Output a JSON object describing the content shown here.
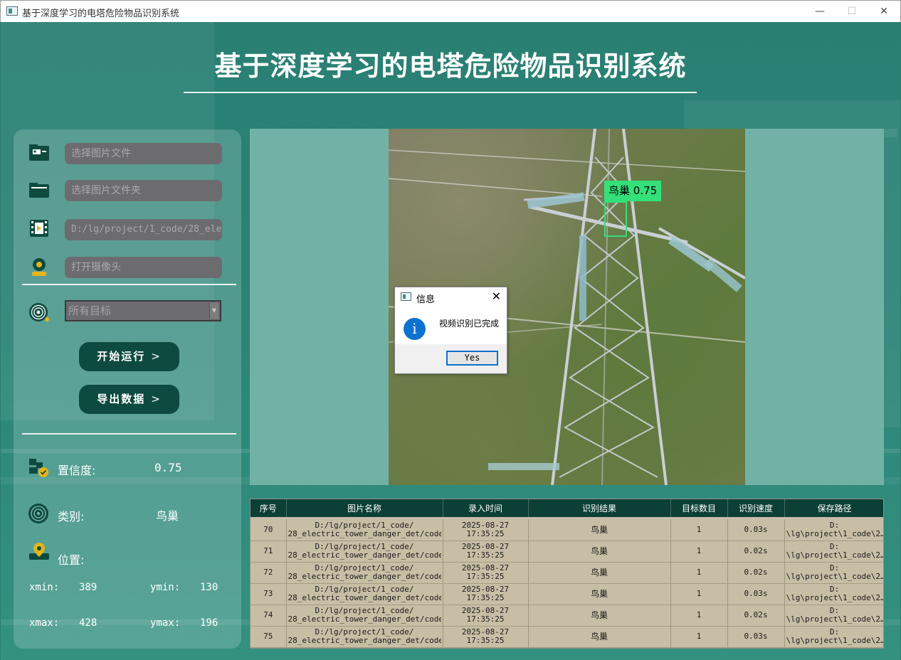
{
  "window": {
    "title": "基于深度学习的电塔危险物品识别系统",
    "minimize_glyph": "—",
    "maximize_glyph": "☐",
    "close_glyph": "✕"
  },
  "header": {
    "title": "基于深度学习的电塔危险物品识别系统"
  },
  "sidebar": {
    "image_file_placeholder": "选择图片文件",
    "image_folder_placeholder": "选择图片文件夹",
    "video_path": "D:/lg/project/1_code/28_ele",
    "camera_placeholder": "打开摄像头",
    "target_select_value": "所有目标",
    "start_button": "开始运行",
    "export_button": "导出数据",
    "chevron": ">",
    "confidence_label": "置信度:",
    "confidence_value": "0.75",
    "category_label": "类别:",
    "category_value": "鸟巢",
    "position_label": "位置:",
    "xmin_label": "xmin:",
    "xmin_value": "389",
    "ymin_label": "ymin:",
    "ymin_value": "130",
    "xmax_label": "xmax:",
    "xmax_value": "428",
    "ymax_label": "ymax:",
    "ymax_value": "196"
  },
  "detection": {
    "label": "鸟巢 0.75"
  },
  "dialog": {
    "title": "信息",
    "close_glyph": "✕",
    "info_glyph": "i",
    "message": "视频识别已完成",
    "yes_button": "Yes"
  },
  "table": {
    "headers": [
      "序号",
      "图片名称",
      "录入时间",
      "识别结果",
      "目标数目",
      "识别速度",
      "保存路径"
    ],
    "rows": [
      {
        "id": "70",
        "name1": "D:/lg/project/1_code/",
        "name2": "28_electric_tower_danger_det/code…",
        "date": "2025-08-27",
        "time": "17:35:25",
        "result": "鸟巢",
        "count": "1",
        "speed": "0.03s",
        "path1": "D:",
        "path2": "\\lg\\project\\1_code\\2…"
      },
      {
        "id": "71",
        "name1": "D:/lg/project/1_code/",
        "name2": "28_electric_tower_danger_det/code…",
        "date": "2025-08-27",
        "time": "17:35:25",
        "result": "鸟巢",
        "count": "1",
        "speed": "0.02s",
        "path1": "D:",
        "path2": "\\lg\\project\\1_code\\2…"
      },
      {
        "id": "72",
        "name1": "D:/lg/project/1_code/",
        "name2": "28_electric_tower_danger_det/code…",
        "date": "2025-08-27",
        "time": "17:35:25",
        "result": "鸟巢",
        "count": "1",
        "speed": "0.02s",
        "path1": "D:",
        "path2": "\\lg\\project\\1_code\\2…"
      },
      {
        "id": "73",
        "name1": "D:/lg/project/1_code/",
        "name2": "28_electric_tower_danger_det/code…",
        "date": "2025-08-27",
        "time": "17:35:25",
        "result": "鸟巢",
        "count": "1",
        "speed": "0.03s",
        "path1": "D:",
        "path2": "\\lg\\project\\1_code\\2…"
      },
      {
        "id": "74",
        "name1": "D:/lg/project/1_code/",
        "name2": "28_electric_tower_danger_det/code…",
        "date": "2025-08-27",
        "time": "17:35:25",
        "result": "鸟巢",
        "count": "1",
        "speed": "0.02s",
        "path1": "D:",
        "path2": "\\lg\\project\\1_code\\2…"
      },
      {
        "id": "75",
        "name1": "D:/lg/project/1_code/",
        "name2": "28_electric_tower_danger_det/code…",
        "date": "2025-08-27",
        "time": "17:35:25",
        "result": "鸟巢",
        "count": "1",
        "speed": "0.03s",
        "path1": "D:",
        "path2": "\\lg\\project\\1_code\\2…"
      }
    ]
  },
  "colors": {
    "background": "#2a7d70",
    "button": "#0d4a3f",
    "detection_box": "#33e07a",
    "table_header": "#0c3f36",
    "table_cell": "#c7bea6"
  }
}
